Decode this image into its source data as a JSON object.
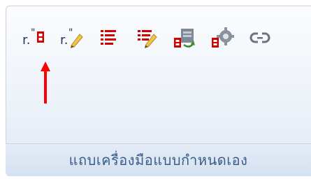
{
  "toolbar": {
    "buttons": [
      {
        "name": "insert-shortcut-icon"
      },
      {
        "name": "edit-shortcut-icon"
      },
      {
        "name": "list-icon"
      },
      {
        "name": "edit-list-icon"
      },
      {
        "name": "refresh-shortcut-icon"
      },
      {
        "name": "settings-shortcut-icon"
      },
      {
        "name": "link-icon"
      }
    ]
  },
  "group": {
    "label": "แถบเครื่องมือแบบกำหนดเอง"
  },
  "colors": {
    "accent_red": "#d10000",
    "label_blue": "#3b5d87"
  }
}
